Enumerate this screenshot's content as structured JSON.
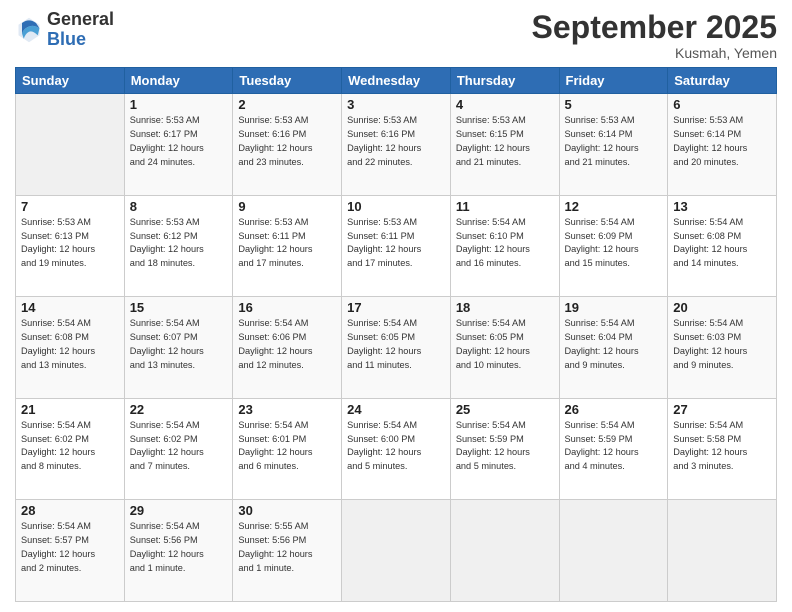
{
  "logo": {
    "line1": "General",
    "line2": "Blue"
  },
  "title": "September 2025",
  "location": "Kusmah, Yemen",
  "weekdays": [
    "Sunday",
    "Monday",
    "Tuesday",
    "Wednesday",
    "Thursday",
    "Friday",
    "Saturday"
  ],
  "weeks": [
    [
      {
        "day": "",
        "info": ""
      },
      {
        "day": "1",
        "info": "Sunrise: 5:53 AM\nSunset: 6:17 PM\nDaylight: 12 hours\nand 24 minutes."
      },
      {
        "day": "2",
        "info": "Sunrise: 5:53 AM\nSunset: 6:16 PM\nDaylight: 12 hours\nand 23 minutes."
      },
      {
        "day": "3",
        "info": "Sunrise: 5:53 AM\nSunset: 6:16 PM\nDaylight: 12 hours\nand 22 minutes."
      },
      {
        "day": "4",
        "info": "Sunrise: 5:53 AM\nSunset: 6:15 PM\nDaylight: 12 hours\nand 21 minutes."
      },
      {
        "day": "5",
        "info": "Sunrise: 5:53 AM\nSunset: 6:14 PM\nDaylight: 12 hours\nand 21 minutes."
      },
      {
        "day": "6",
        "info": "Sunrise: 5:53 AM\nSunset: 6:14 PM\nDaylight: 12 hours\nand 20 minutes."
      }
    ],
    [
      {
        "day": "7",
        "info": "Sunrise: 5:53 AM\nSunset: 6:13 PM\nDaylight: 12 hours\nand 19 minutes."
      },
      {
        "day": "8",
        "info": "Sunrise: 5:53 AM\nSunset: 6:12 PM\nDaylight: 12 hours\nand 18 minutes."
      },
      {
        "day": "9",
        "info": "Sunrise: 5:53 AM\nSunset: 6:11 PM\nDaylight: 12 hours\nand 17 minutes."
      },
      {
        "day": "10",
        "info": "Sunrise: 5:53 AM\nSunset: 6:11 PM\nDaylight: 12 hours\nand 17 minutes."
      },
      {
        "day": "11",
        "info": "Sunrise: 5:54 AM\nSunset: 6:10 PM\nDaylight: 12 hours\nand 16 minutes."
      },
      {
        "day": "12",
        "info": "Sunrise: 5:54 AM\nSunset: 6:09 PM\nDaylight: 12 hours\nand 15 minutes."
      },
      {
        "day": "13",
        "info": "Sunrise: 5:54 AM\nSunset: 6:08 PM\nDaylight: 12 hours\nand 14 minutes."
      }
    ],
    [
      {
        "day": "14",
        "info": "Sunrise: 5:54 AM\nSunset: 6:08 PM\nDaylight: 12 hours\nand 13 minutes."
      },
      {
        "day": "15",
        "info": "Sunrise: 5:54 AM\nSunset: 6:07 PM\nDaylight: 12 hours\nand 13 minutes."
      },
      {
        "day": "16",
        "info": "Sunrise: 5:54 AM\nSunset: 6:06 PM\nDaylight: 12 hours\nand 12 minutes."
      },
      {
        "day": "17",
        "info": "Sunrise: 5:54 AM\nSunset: 6:05 PM\nDaylight: 12 hours\nand 11 minutes."
      },
      {
        "day": "18",
        "info": "Sunrise: 5:54 AM\nSunset: 6:05 PM\nDaylight: 12 hours\nand 10 minutes."
      },
      {
        "day": "19",
        "info": "Sunrise: 5:54 AM\nSunset: 6:04 PM\nDaylight: 12 hours\nand 9 minutes."
      },
      {
        "day": "20",
        "info": "Sunrise: 5:54 AM\nSunset: 6:03 PM\nDaylight: 12 hours\nand 9 minutes."
      }
    ],
    [
      {
        "day": "21",
        "info": "Sunrise: 5:54 AM\nSunset: 6:02 PM\nDaylight: 12 hours\nand 8 minutes."
      },
      {
        "day": "22",
        "info": "Sunrise: 5:54 AM\nSunset: 6:02 PM\nDaylight: 12 hours\nand 7 minutes."
      },
      {
        "day": "23",
        "info": "Sunrise: 5:54 AM\nSunset: 6:01 PM\nDaylight: 12 hours\nand 6 minutes."
      },
      {
        "day": "24",
        "info": "Sunrise: 5:54 AM\nSunset: 6:00 PM\nDaylight: 12 hours\nand 5 minutes."
      },
      {
        "day": "25",
        "info": "Sunrise: 5:54 AM\nSunset: 5:59 PM\nDaylight: 12 hours\nand 5 minutes."
      },
      {
        "day": "26",
        "info": "Sunrise: 5:54 AM\nSunset: 5:59 PM\nDaylight: 12 hours\nand 4 minutes."
      },
      {
        "day": "27",
        "info": "Sunrise: 5:54 AM\nSunset: 5:58 PM\nDaylight: 12 hours\nand 3 minutes."
      }
    ],
    [
      {
        "day": "28",
        "info": "Sunrise: 5:54 AM\nSunset: 5:57 PM\nDaylight: 12 hours\nand 2 minutes."
      },
      {
        "day": "29",
        "info": "Sunrise: 5:54 AM\nSunset: 5:56 PM\nDaylight: 12 hours\nand 1 minute."
      },
      {
        "day": "30",
        "info": "Sunrise: 5:55 AM\nSunset: 5:56 PM\nDaylight: 12 hours\nand 1 minute."
      },
      {
        "day": "",
        "info": ""
      },
      {
        "day": "",
        "info": ""
      },
      {
        "day": "",
        "info": ""
      },
      {
        "day": "",
        "info": ""
      }
    ]
  ]
}
